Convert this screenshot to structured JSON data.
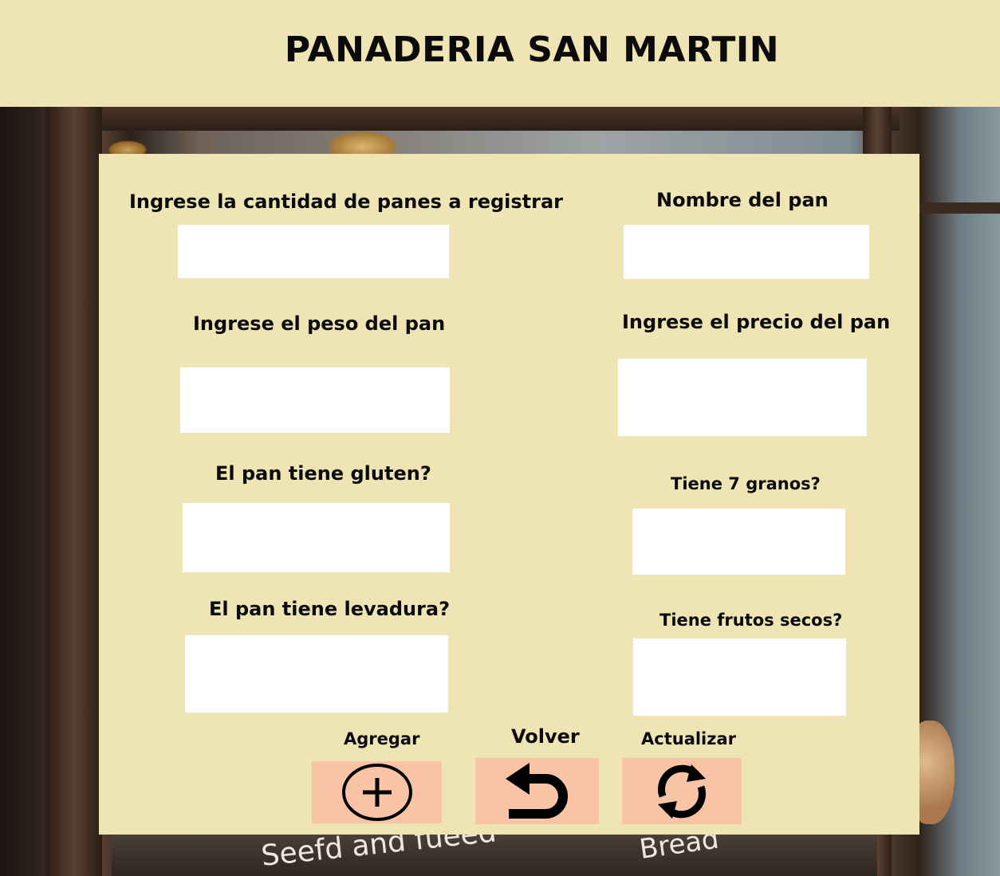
{
  "header": {
    "title": "PANADERIA SAN MARTIN"
  },
  "background": {
    "chalk_left": "Seefd  and fueed",
    "chalk_right": "Bread"
  },
  "form": {
    "cantidad_label": "Ingrese la cantidad de panes a registrar",
    "cantidad_value": "",
    "nombre_label": "Nombre del pan",
    "nombre_value": "",
    "peso_label": "Ingrese el peso del pan",
    "peso_value": "",
    "precio_label": "Ingrese el precio del pan",
    "precio_value": "",
    "gluten_label": "El pan tiene gluten?",
    "gluten_value": "",
    "granos_label": "Tiene 7 granos?",
    "granos_value": "",
    "levadura_label": "El pan tiene levadura?",
    "levadura_value": "",
    "frutos_label": "Tiene frutos secos?",
    "frutos_value": ""
  },
  "actions": {
    "agregar_label": "Agregar",
    "volver_label": "Volver",
    "actualizar_label": "Actualizar",
    "agregar_icon": "plus-circle-icon",
    "volver_icon": "undo-arrow-icon",
    "actualizar_icon": "refresh-icon",
    "button_color": "#f9c3a6"
  },
  "colors": {
    "panel": "#efe4b4",
    "header": "#efe4b4",
    "text": "#0b0b0b",
    "field": "#ffffff"
  }
}
